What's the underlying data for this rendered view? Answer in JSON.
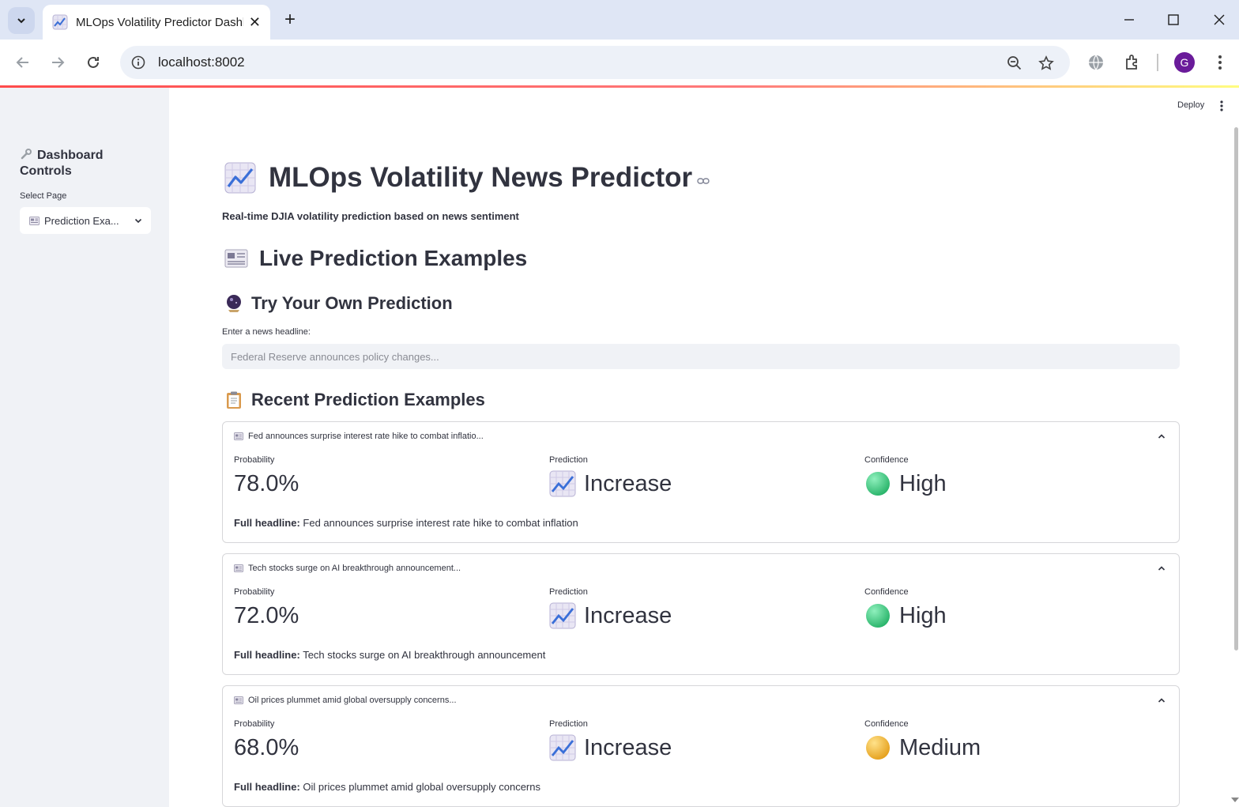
{
  "browser": {
    "tab_title": "MLOps Volatility Predictor Dashboard",
    "url": "localhost:8002",
    "profile_initial": "G"
  },
  "sidebar": {
    "title": "Dashboard Controls",
    "select_label": "Select Page",
    "select_value": "Prediction Exa..."
  },
  "header": {
    "deploy_label": "Deploy"
  },
  "main": {
    "title": "MLOps Volatility News Predictor",
    "subtitle": "Real-time DJIA volatility prediction based on news sentiment",
    "section_title": "Live Prediction Examples",
    "try_title": "Try Your Own Prediction",
    "input_label": "Enter a news headline:",
    "input_placeholder": "Federal Reserve announces policy changes...",
    "recent_title": "Recent Prediction Examples",
    "metric_labels": {
      "probability": "Probability",
      "prediction": "Prediction",
      "confidence": "Confidence"
    },
    "full_headline_label": "Full headline:",
    "examples": [
      {
        "summary": "Fed announces surprise interest rate hike to combat inflatio...",
        "probability": "78.0%",
        "prediction": "Increase",
        "confidence": "High",
        "full_headline": "Fed announces surprise interest rate hike to combat inflation",
        "confidence_color": "#3ec97f"
      },
      {
        "summary": "Tech stocks surge on AI breakthrough announcement...",
        "probability": "72.0%",
        "prediction": "Increase",
        "confidence": "High",
        "full_headline": "Tech stocks surge on AI breakthrough announcement",
        "confidence_color": "#3ec97f"
      },
      {
        "summary": "Oil prices plummet amid global oversupply concerns...",
        "probability": "68.0%",
        "prediction": "Increase",
        "confidence": "Medium",
        "full_headline": "Oil prices plummet amid global oversupply concerns",
        "confidence_color": "#f2b431"
      }
    ]
  },
  "icons": {
    "title_emoji": "chart-increasing-icon",
    "section_emoji": "newspaper-icon",
    "try_emoji": "crystal-ball-icon",
    "recent_emoji": "clipboard-icon",
    "sidebar_emoji": "wrench-icon"
  },
  "colors": {
    "accent": "#ff4b4b",
    "sidebar_bg": "#f0f2f6",
    "text": "#31333f"
  }
}
